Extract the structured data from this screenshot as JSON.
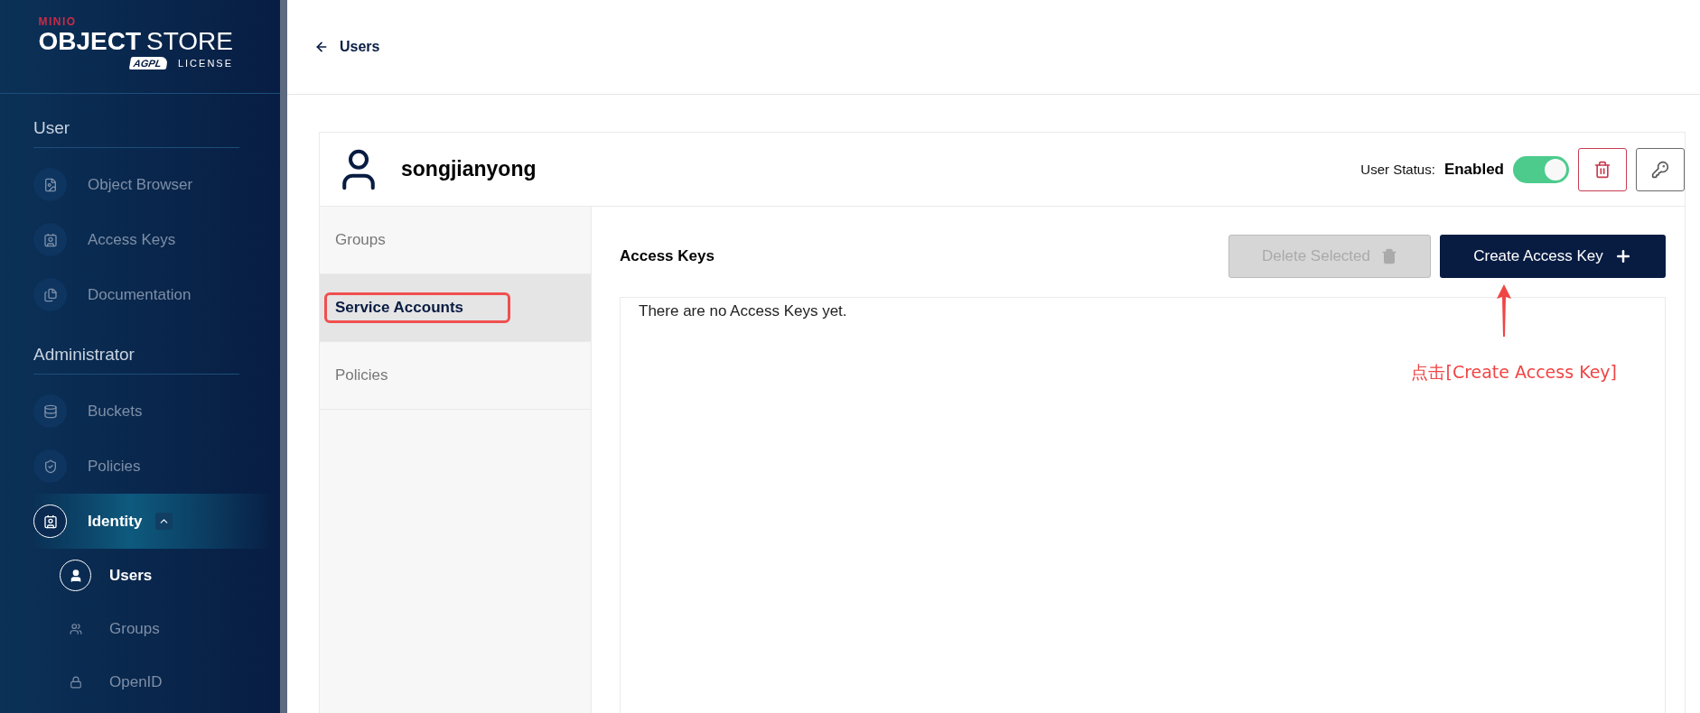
{
  "sidebar": {
    "logo": {
      "brand": "MINIO",
      "title_bold": "OBJECT",
      "title_light": "STORE",
      "badge": "AGPL",
      "license": "LICENSE"
    },
    "sections": [
      {
        "title": "User",
        "items": [
          {
            "label": "Object Browser",
            "selected": false
          },
          {
            "label": "Access Keys",
            "selected": false
          },
          {
            "label": "Documentation",
            "selected": false
          }
        ]
      },
      {
        "title": "Administrator",
        "items": [
          {
            "label": "Buckets",
            "selected": false
          },
          {
            "label": "Policies",
            "selected": false
          },
          {
            "label": "Identity",
            "selected": true,
            "expanded": true,
            "children": [
              {
                "label": "Users",
                "selected": true
              },
              {
                "label": "Groups",
                "selected": false
              },
              {
                "label": "OpenID",
                "selected": false
              }
            ]
          }
        ]
      }
    ]
  },
  "header": {
    "back_label": "Users"
  },
  "user_card": {
    "name": "songjianyong",
    "status_label": "User Status:",
    "status_value": "Enabled",
    "status_on": true,
    "tabs": [
      {
        "label": "Groups",
        "selected": false,
        "highlighted": false
      },
      {
        "label": "Service Accounts",
        "selected": true,
        "highlighted": true
      },
      {
        "label": "Policies",
        "selected": false,
        "highlighted": false
      }
    ],
    "panel": {
      "title": "Access Keys",
      "delete_button": {
        "label": "Delete Selected",
        "disabled": true
      },
      "create_button": {
        "label": "Create Access Key"
      },
      "empty_text": "There are no Access Keys yet."
    }
  },
  "annotation": {
    "note": "点击[Create Access Key]"
  }
}
